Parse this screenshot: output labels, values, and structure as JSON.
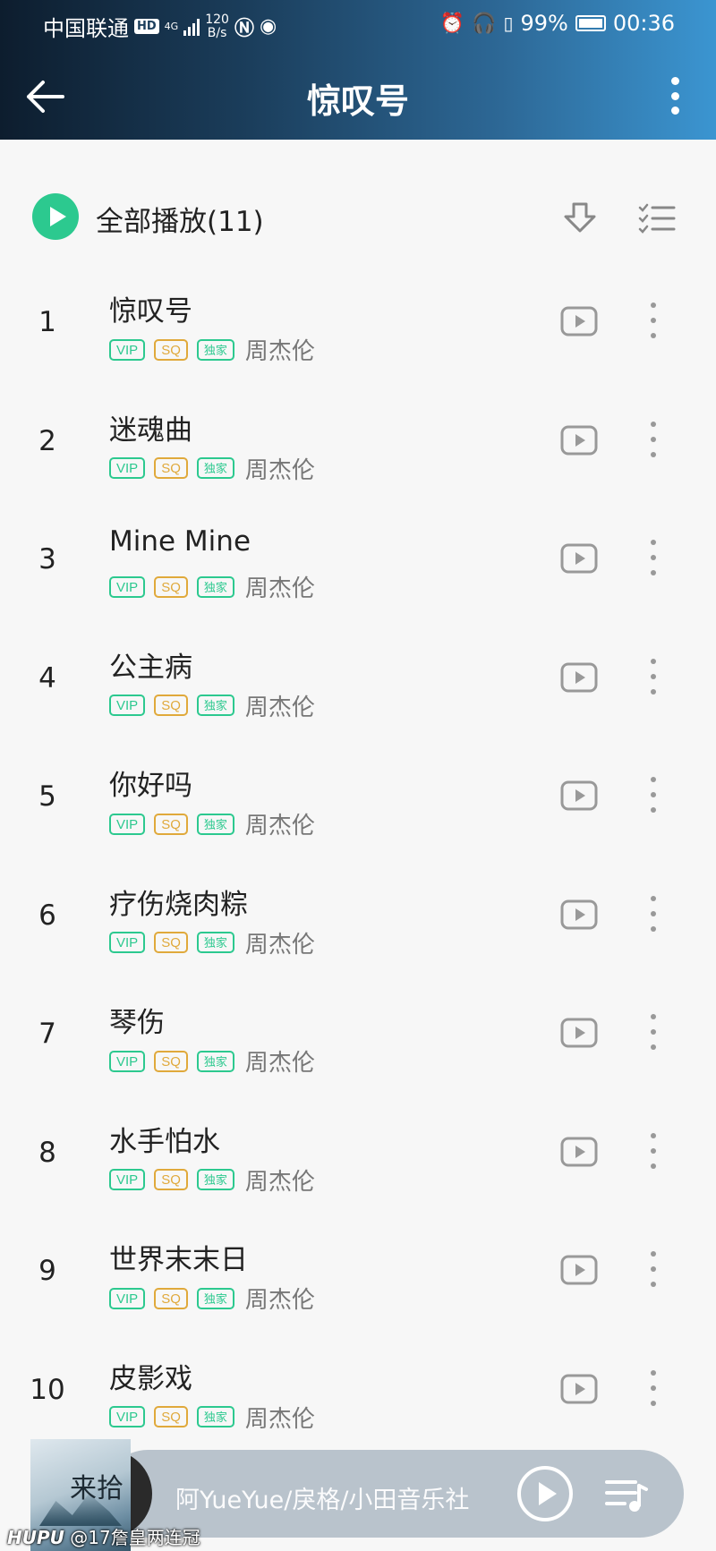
{
  "status_bar": {
    "carrier": "中国联通",
    "hd": "HD",
    "network": "4G",
    "speed_value": "120",
    "speed_unit": "B/s",
    "battery": "99%",
    "time": "00:36"
  },
  "header": {
    "title": "惊叹号",
    "back_icon": "arrow-left-icon",
    "more_icon": "more-vertical-icon"
  },
  "play_all": {
    "label": "全部播放(11)",
    "download_icon": "download-icon",
    "multi_select_icon": "multi-select-icon"
  },
  "tag_labels": {
    "vip": "VIP",
    "sq": "SQ",
    "exclusive": "独家"
  },
  "songs": [
    {
      "index": "1",
      "title": "惊叹号",
      "artist": "周杰伦"
    },
    {
      "index": "2",
      "title": "迷魂曲",
      "artist": "周杰伦"
    },
    {
      "index": "3",
      "title": "Mine Mine",
      "artist": "周杰伦"
    },
    {
      "index": "4",
      "title": "公主病",
      "artist": "周杰伦"
    },
    {
      "index": "5",
      "title": "你好吗",
      "artist": "周杰伦"
    },
    {
      "index": "6",
      "title": "疗伤烧肉粽",
      "artist": "周杰伦"
    },
    {
      "index": "7",
      "title": "琴伤",
      "artist": "周杰伦"
    },
    {
      "index": "8",
      "title": "水手怕水",
      "artist": "周杰伦"
    },
    {
      "index": "9",
      "title": "世界末末日",
      "artist": "周杰伦"
    },
    {
      "index": "10",
      "title": "皮影戏",
      "artist": "周杰伦"
    }
  ],
  "mini_player": {
    "now_playing": "阿YueYue/戾格/小田音乐社",
    "cover_text": "来拾",
    "play_icon": "play-circle-icon",
    "playlist_icon": "playlist-icon"
  },
  "watermark": {
    "brand": "HUPU",
    "text": "@17詹皇两连冠"
  },
  "colors": {
    "accent": "#2cc98f",
    "sq": "#e0a93b",
    "header_start": "#0d1d2e",
    "header_end": "#3b95d1"
  }
}
